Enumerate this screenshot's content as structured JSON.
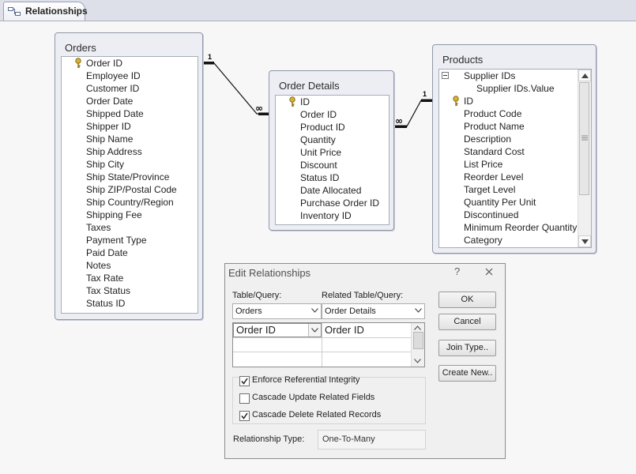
{
  "tab": {
    "label": "Relationships"
  },
  "orders": {
    "title": "Orders",
    "fields": [
      "Order ID",
      "Employee ID",
      "Customer ID",
      "Order Date",
      "Shipped Date",
      "Shipper ID",
      "Ship Name",
      "Ship Address",
      "Ship City",
      "Ship State/Province",
      "Ship ZIP/Postal Code",
      "Ship Country/Region",
      "Shipping Fee",
      "Taxes",
      "Payment Type",
      "Paid Date",
      "Notes",
      "Tax Rate",
      "Tax Status",
      "Status ID"
    ]
  },
  "order_details": {
    "title": "Order Details",
    "fields": [
      "ID",
      "Order ID",
      "Product ID",
      "Quantity",
      "Unit Price",
      "Discount",
      "Status ID",
      "Date Allocated",
      "Purchase Order ID",
      "Inventory ID"
    ]
  },
  "products": {
    "title": "Products",
    "fields": [
      "Supplier IDs",
      "Supplier IDs.Value",
      "ID",
      "Product Code",
      "Product Name",
      "Description",
      "Standard Cost",
      "List Price",
      "Reorder Level",
      "Target Level",
      "Quantity Per Unit",
      "Discontinued",
      "Minimum Reorder Quantity",
      "Category"
    ]
  },
  "relationships": {
    "one_symbol": "1",
    "many_symbol": "∞"
  },
  "dialog": {
    "title": "Edit Relationships",
    "help": "?",
    "table_label": "Table/Query:",
    "related_label": "Related Table/Query:",
    "table_value": "Orders",
    "related_value": "Order Details",
    "field_left": "Order ID",
    "field_right": "Order ID",
    "ok": "OK",
    "cancel": "Cancel",
    "join_type": "Join Type..",
    "create_new": "Create New..",
    "enforce": "Enforce Referential Integrity",
    "cascade_update": "Cascade Update Related Fields",
    "cascade_delete": "Cascade Delete Related Records",
    "enforce_checked": true,
    "cascade_update_checked": false,
    "cascade_delete_checked": true,
    "rel_type_label": "Relationship Type:",
    "rel_type_value": "One-To-Many"
  }
}
